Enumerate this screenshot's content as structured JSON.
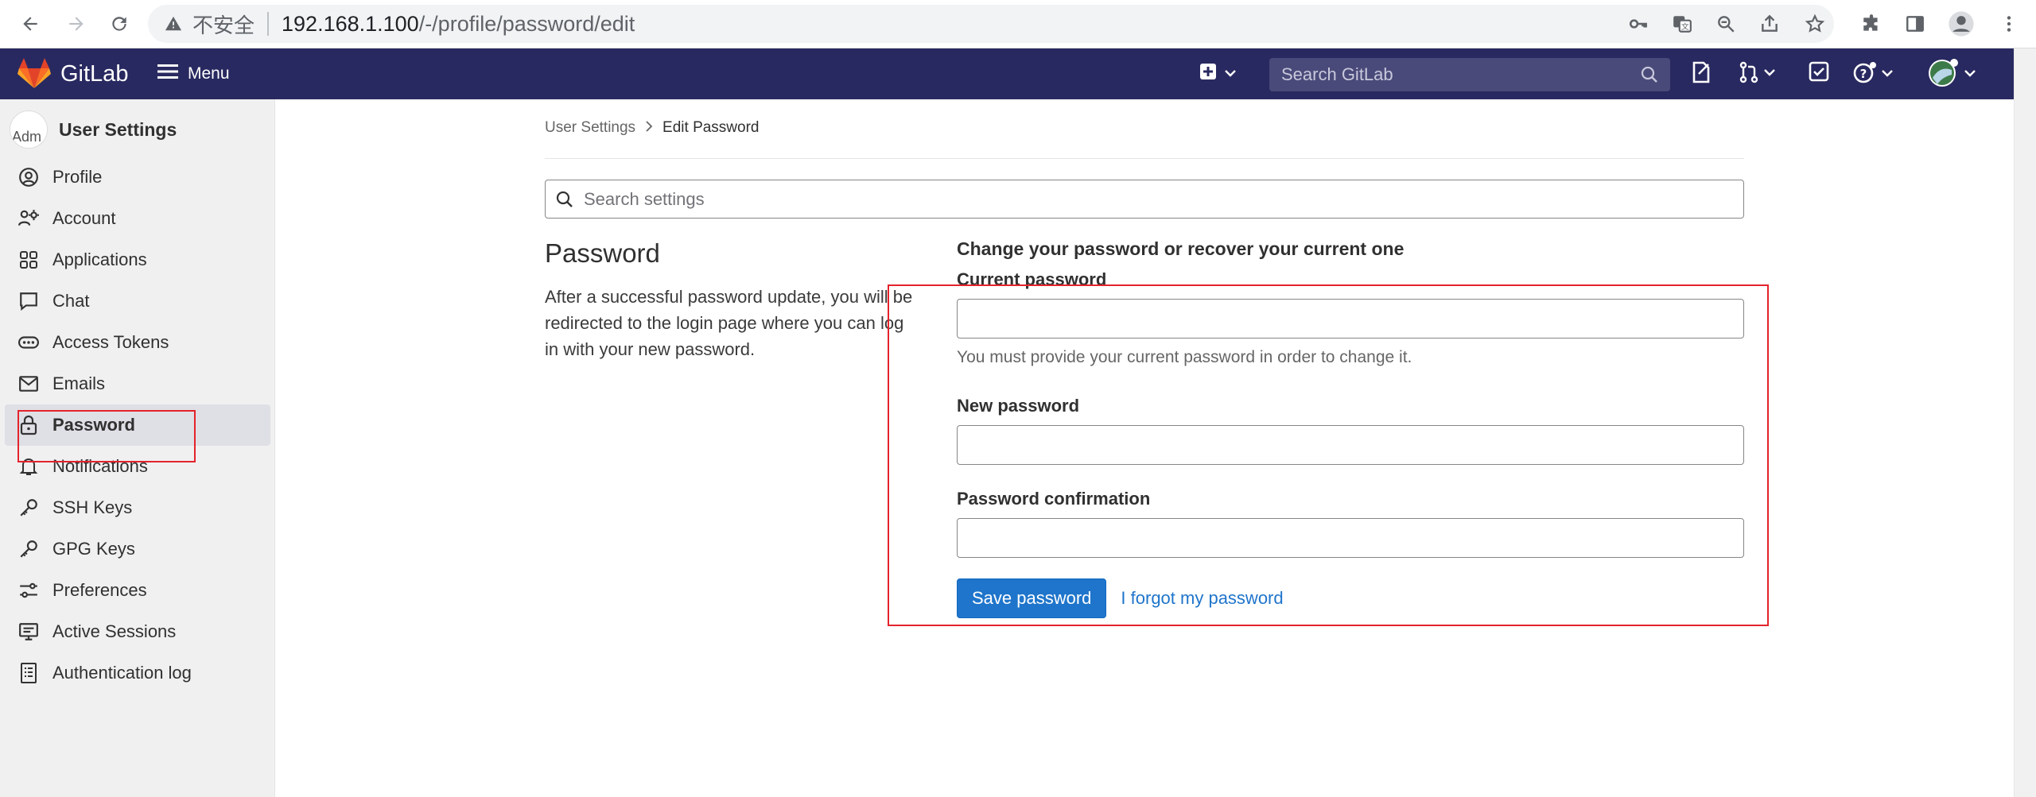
{
  "browser": {
    "insecure_label": "不安全",
    "url_host": "192.168.1.100",
    "url_path": "/-/profile/password/edit"
  },
  "topnav": {
    "brand": "GitLab",
    "menu_label": "Menu",
    "search_placeholder": "Search GitLab",
    "brand_color": "#292961"
  },
  "sidebar": {
    "title": "User Settings",
    "avatar_alt": "Adm",
    "items": [
      {
        "label": "Profile",
        "icon": "profile-icon"
      },
      {
        "label": "Account",
        "icon": "account-icon"
      },
      {
        "label": "Applications",
        "icon": "applications-icon"
      },
      {
        "label": "Chat",
        "icon": "chat-icon"
      },
      {
        "label": "Access Tokens",
        "icon": "token-icon"
      },
      {
        "label": "Emails",
        "icon": "envelope-icon"
      },
      {
        "label": "Password",
        "icon": "lock-icon",
        "active": true
      },
      {
        "label": "Notifications",
        "icon": "bell-icon"
      },
      {
        "label": "SSH Keys",
        "icon": "key-icon"
      },
      {
        "label": "GPG Keys",
        "icon": "key-icon"
      },
      {
        "label": "Preferences",
        "icon": "preferences-icon"
      },
      {
        "label": "Active Sessions",
        "icon": "monitor-icon"
      },
      {
        "label": "Authentication log",
        "icon": "log-icon"
      }
    ]
  },
  "breadcrumb": {
    "parent": "User Settings",
    "current": "Edit Password"
  },
  "settings_search": {
    "placeholder": "Search settings"
  },
  "password_section": {
    "title": "Password",
    "description": "After a successful password update, you will be redirected to the login page where you can log in with your new password.",
    "form_heading": "Change your password or recover your current one",
    "current_label": "Current password",
    "current_help": "You must provide your current password in order to change it.",
    "new_label": "New password",
    "confirm_label": "Password confirmation",
    "save_label": "Save password",
    "forgot_label": "I forgot my password"
  },
  "colors": {
    "primary": "#1f75cb",
    "annotation": "#e4232b"
  }
}
